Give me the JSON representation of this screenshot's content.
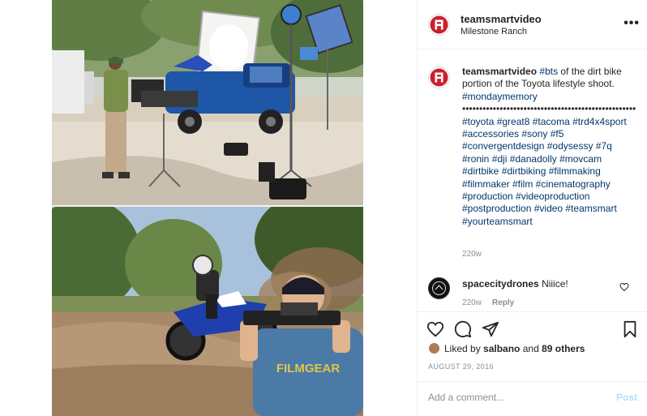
{
  "post": {
    "author": "teamsmartvideo",
    "location": "Milestone Ranch",
    "more_icon": "more-options-icon"
  },
  "caption": {
    "author": "teamsmartvideo",
    "text_parts": [
      {
        "kind": "tag",
        "text": "#bts"
      },
      {
        "kind": "text",
        "text": " of the dirt bike portion of the Toyota lifestyle shoot. "
      },
      {
        "kind": "tag",
        "text": "#mondaymemory"
      }
    ],
    "dots": "•••••••••••••••••••••••••••••••••••••••••••••••••••",
    "hashtags": "#toyota #great8 #tacoma #trd4x4sport #accessories #sony #f5 #convergentdesign #odysessy #7q #ronin #dji #danadolly #movcam #dirtbike #dirtbiking #filmmaking #filmmaker #film #cinematography #production #videoproduction #postproduction #video #teamsmart #yourteamsmart",
    "timestamp": "220w"
  },
  "comments": [
    {
      "author": "spacecitydrones",
      "text": "Niiice!",
      "timestamp": "220w",
      "reply_label": "Reply"
    }
  ],
  "likes": {
    "prefix": "Liked by ",
    "user": "salbano",
    "connector": " and ",
    "others": "89 others"
  },
  "date": "AUGUST 29, 2016",
  "comment_box": {
    "placeholder": "Add a comment...",
    "post_label": "Post"
  },
  "photo": {
    "shirt_text": "FILMGEAR"
  },
  "colors": {
    "hashtag": "#00376b",
    "muted": "#8e8e8e",
    "post_button": "#b2dffc",
    "border": "#efefef"
  }
}
